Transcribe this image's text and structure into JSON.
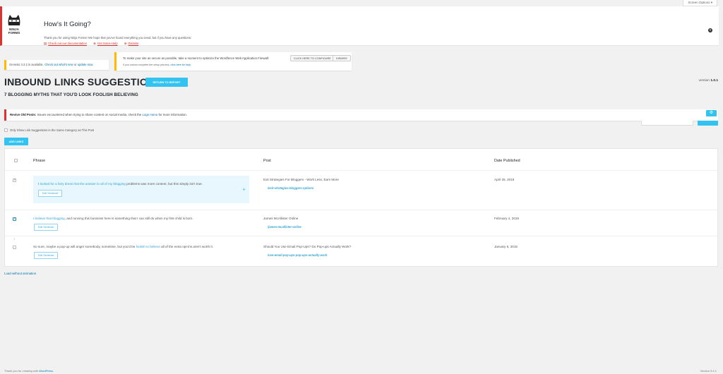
{
  "screen_options": "Screen Options ▾",
  "ninja_notice": {
    "logo_text": "NINJA FORMS",
    "title": "How's It Going?",
    "text": "Thank you for using Ninja Forms! We hope that you've found everything you need, but if you have any questions:",
    "links": [
      "Check out our documentation",
      "Get Some Help",
      "Dismiss"
    ],
    "close": "×"
  },
  "genesis_notice": {
    "prefix": "Genesis 3.3.2 is available.",
    "link1": "Check out what's new",
    "mid": "or",
    "link2": "update now",
    "suffix": "."
  },
  "wordfence_notice": {
    "text": "To make your site as secure as possible, take a moment to optimize the Wordfence Web Application Firewall:",
    "configure_label": "CLICK HERE TO CONFIGURE",
    "dismiss_label": "DISMISS",
    "sub_text": "If you cannot complete the setup process,",
    "sub_link": "click here for help."
  },
  "header": {
    "title": "INBOUND LINKS SUGGESTIONS",
    "return_label": "RETURN TO REPORT",
    "version_label": "version",
    "version_number": "1.0.1",
    "post_title": "7 BLOGGING MYTHS THAT YOU'D LOOK FOOLISH BELIEVING"
  },
  "rop_notice": {
    "bold": "Revive Old Posts:",
    "text": "Issues encountered when trying to share content on social media, check the",
    "link": "Logs menu",
    "suffix": "for more information.",
    "gear": "⚙"
  },
  "filter": {
    "label": "Only Show Link Suggestions in the Same Category as This Post"
  },
  "add_links_label": "ADD LINKS",
  "table": {
    "headers": {
      "phrase": "Phrase",
      "post": "Post",
      "date": "Date Published"
    },
    "rows": [
      {
        "before": "I ",
        "link": "looked for a fairy dress that the answer to all of my blogging",
        "after": " problems was more content, but this simply isn't true.",
        "edit_label": "Edit Sentence",
        "post_title": "Exit Strategies For Bloggers - Work Less, Earn More",
        "post_slug": "/exit-strategies-bloggers-options",
        "date": "April 25, 2018"
      },
      {
        "before": "",
        "link": "I believe that blogging",
        "after": ", and running this business here is something that I can still do when my first child is born.",
        "edit_label": "Edit Sentence",
        "post_title": "James McAllister Online",
        "post_slug": "/james-mcallister-online",
        "date": "February 4, 2019"
      },
      {
        "before": "So sure, maybe a pop-up will anger somebody, sometime, but you'd be ",
        "link": "foolish to believe",
        "after": " all of the extra opt-ins aren't worth it.",
        "edit_label": "Edit Sentence",
        "post_title": "Should You Use Email Pop-Ups? Do Pop-ups Actually Work?",
        "post_slug": "/use-email-pop-ups-pop-ups-actually-work",
        "date": "January 6, 2015"
      }
    ]
  },
  "load_without": "Load without animation",
  "footer": {
    "thanks_prefix": "Thank you for creating with",
    "thanks_link": "WordPress",
    "thanks_suffix": ".",
    "version": "Version 5.4.1"
  },
  "colors": {
    "accent": "#33c3f0",
    "error": "#dc3232",
    "warning": "#ffb900",
    "link": "#0073aa"
  }
}
